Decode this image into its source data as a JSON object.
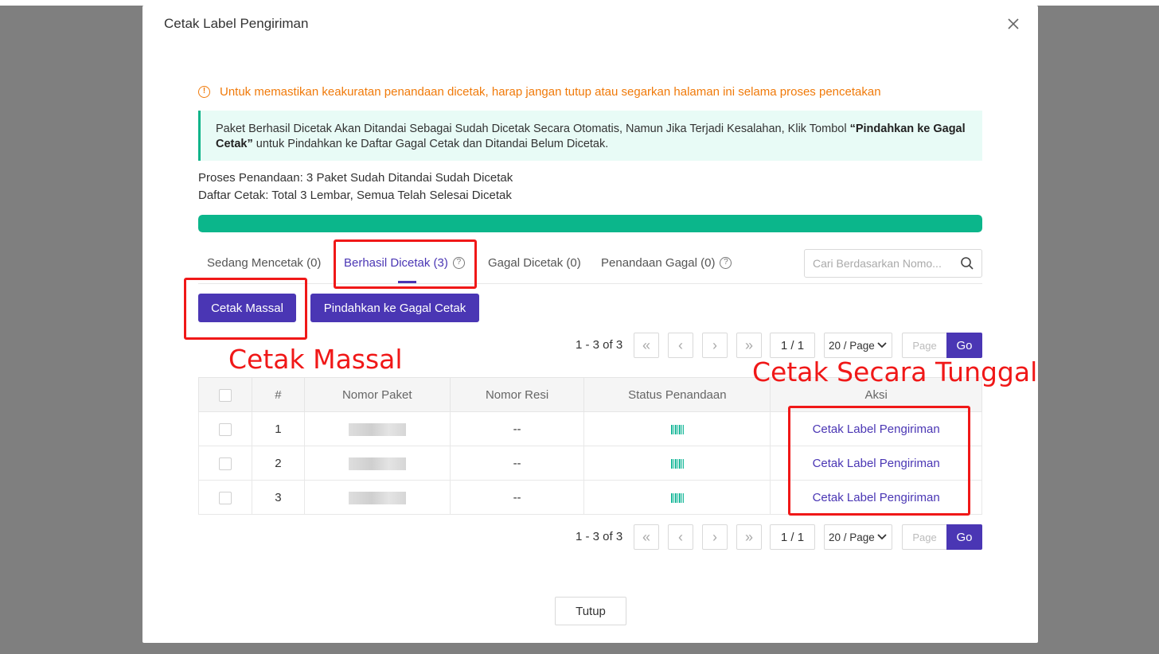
{
  "modal": {
    "title": "Cetak Label Pengiriman",
    "warning": "Untuk memastikan keakuratan penandaan dicetak, harap jangan tutup atau segarkan halaman ini selama proses pencetakan",
    "info_part1": "Paket Berhasil Dicetak Akan Ditandai Sebagai Sudah Dicetak Secara Otomatis, Namun Jika Terjadi Kesalahan, Klik Tombol ",
    "info_bold": "“Pindahkan ke Gagal Cetak”",
    "info_part2": " untuk Pindahkan ke Daftar Gagal Cetak dan Ditandai Belum Dicetak.",
    "status_marking": "Proses Penandaan: 3 Paket Sudah Ditandai Sudah Dicetak",
    "status_print": "Daftar Cetak: Total 3 Lembar, Semua Telah Selesai Dicetak",
    "progress_fraction": 1.0,
    "close_label": "Tutup"
  },
  "tabs": [
    {
      "label": "Sedang Mencetak (0)"
    },
    {
      "label": "Berhasil Dicetak (3)"
    },
    {
      "label": "Gagal Dicetak (0)"
    },
    {
      "label": "Penandaan Gagal (0)"
    }
  ],
  "search": {
    "placeholder": "Cari Berdasarkan Nomo..."
  },
  "actions": {
    "bulk_print": "Cetak Massal",
    "move_to_failed": "Pindahkan ke Gagal Cetak"
  },
  "pagination": {
    "count": "1 - 3 of 3",
    "page_info": "1 / 1",
    "per_page": "20 / Page",
    "page_placeholder": "Page",
    "go": "Go"
  },
  "table": {
    "headers": [
      "#",
      "Nomor Paket",
      "Nomor Resi",
      "Status Penandaan",
      "Aksi"
    ],
    "rows": [
      {
        "no": "1",
        "resi": "--",
        "action": "Cetak Label Pengiriman"
      },
      {
        "no": "2",
        "resi": "--",
        "action": "Cetak Label Pengiriman"
      },
      {
        "no": "3",
        "resi": "--",
        "action": "Cetak Label Pengiriman"
      }
    ]
  },
  "annotations": {
    "bulk": "Cetak Massal",
    "single": "Cetak Secara Tunggal"
  },
  "colors": {
    "primary": "#4a36b4",
    "success": "#0bb68b",
    "warning": "#f07a0a",
    "annotation": "#f01818"
  }
}
